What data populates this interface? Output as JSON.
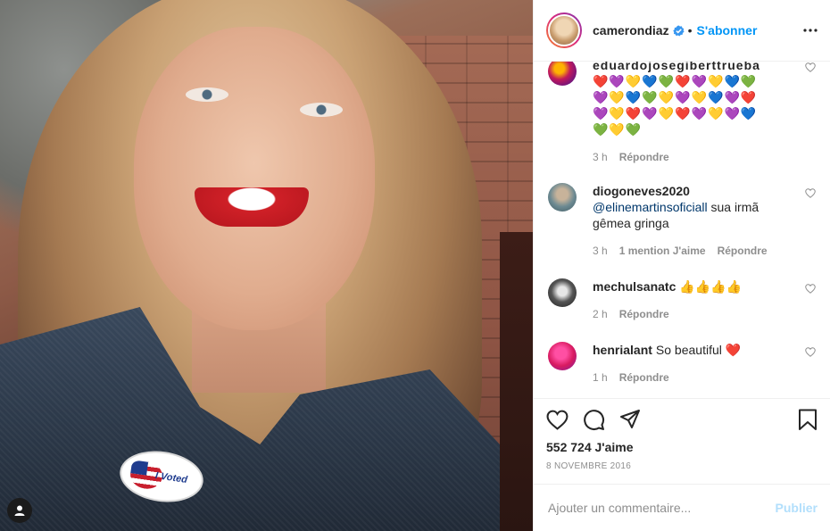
{
  "header": {
    "username": "camerondiaz",
    "separator": "•",
    "follow_label": "S'abonner"
  },
  "comments": [
    {
      "username": "eduardojosegiberttrueba",
      "text": "❤️💜💛💙💚❤️💜💛💙💚💜💛💙💚💛💜💛💙💜❤️💜💛❤️💜💛❤️💜💛💜💙💚💛💚",
      "time": "3 h",
      "likes": "",
      "reply_label": "Répondre",
      "avatar_color": "#c2185b"
    },
    {
      "username": "diogoneves2020",
      "mention": "@elinemartinsoficiall",
      "text": " sua irmã gêmea gringa",
      "time": "3 h",
      "likes": "1 mention J'aime",
      "reply_label": "Répondre",
      "avatar_color": "#5d7b86"
    },
    {
      "username": "mechulsanatc",
      "text": "👍👍👍👍",
      "time": "2 h",
      "likes": "",
      "reply_label": "Répondre",
      "avatar_color": "#3a3a3a"
    },
    {
      "username": "henrialant",
      "text": "So beautiful ❤️",
      "time": "1 h",
      "likes": "",
      "reply_label": "Répondre",
      "avatar_color": "#d81b60"
    }
  ],
  "likes_count": "552 724 J'aime",
  "post_date": "8 NOVEMBRE 2016",
  "add_comment": {
    "placeholder": "Ajouter un commentaire...",
    "post_label": "Publier"
  },
  "photo": {
    "sticker_text": "I Voted"
  },
  "colors": {
    "accent": "#0095f6",
    "publish_disabled": "#b2dffc",
    "muted": "#8e8e8e",
    "text": "#262626"
  },
  "icons": [
    "verified-badge-icon",
    "more-options-icon",
    "heart-icon",
    "comment-icon",
    "share-icon",
    "bookmark-icon",
    "user-tag-icon"
  ]
}
